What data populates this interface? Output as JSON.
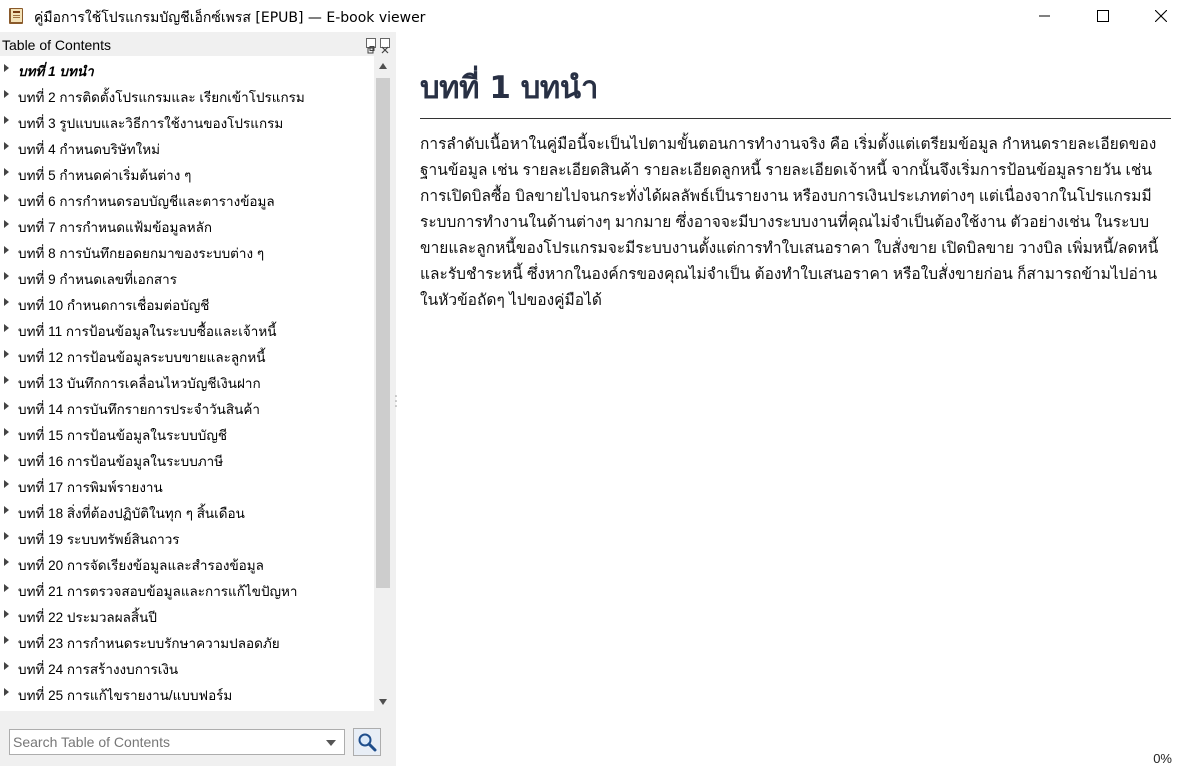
{
  "window": {
    "title": "คู่มือการใช้โปรแกรมบัญชีเอ็กซ์เพรส [EPUB] — E-book viewer",
    "icons": {
      "app": "book-icon",
      "minimize": "minimize-icon",
      "maximize": "maximize-icon",
      "close": "close-icon"
    }
  },
  "sidebar": {
    "header": "Table of Contents",
    "items": [
      {
        "label": "บทที่ 1 บทนำ",
        "current": true
      },
      {
        "label": "บทที่ 2 การติดตั้งโปรแกรมและ เรียกเข้าโปรแกรม"
      },
      {
        "label": "บทที่ 3 รูปแบบและวิธีการใช้งานของโปรแกรม"
      },
      {
        "label": "บทที่ 4 กำหนดบริษัทใหม่"
      },
      {
        "label": "บทที่ 5 กำหนดค่าเริ่มต้นต่าง ๆ"
      },
      {
        "label": "บทที่ 6 การกำหนดรอบบัญชีและตารางข้อมูล"
      },
      {
        "label": "บทที่ 7 การกำหนดแฟ้มข้อมูลหลัก"
      },
      {
        "label": "บทที่ 8 การบันทึกยอดยกมาของระบบต่าง ๆ"
      },
      {
        "label": "บทที่ 9 กำหนดเลขที่เอกสาร"
      },
      {
        "label": "บทที่ 10 กำหนดการเชื่อมต่อบัญชี"
      },
      {
        "label": "บทที่ 11 การป้อนข้อมูลในระบบซื้อและเจ้าหนี้"
      },
      {
        "label": "บทที่ 12  การป้อนข้อมูลระบบขายและลูกหนี้"
      },
      {
        "label": "บทที่ 13 บันทึกการเคลื่อนไหวบัญชีเงินฝาก"
      },
      {
        "label": "บทที่ 14 การบันทึกรายการประจำวันสินค้า"
      },
      {
        "label": "บทที่ 15 การป้อนข้อมูลในระบบบัญชี"
      },
      {
        "label": "บทที่ 16 การป้อนข้อมูลในระบบภาษี"
      },
      {
        "label": "บทที่ 17 การพิมพ์รายงาน"
      },
      {
        "label": "บทที่ 18 สิ่งที่ต้องปฏิบัติในทุก ๆ สิ้นเดือน"
      },
      {
        "label": "บทที่ 19 ระบบทรัพย์สินถาวร"
      },
      {
        "label": "บทที่ 20 การจัดเรียงข้อมูลและสำรองข้อมูล"
      },
      {
        "label": "บทที่ 21 การตรวจสอบข้อมูลและการแก้ไขปัญหา"
      },
      {
        "label": "บทที่ 22 ประมวลผลสิ้นปี"
      },
      {
        "label": "บทที่ 23 การกำหนดระบบรักษาความปลอดภัย"
      },
      {
        "label": "บทที่ 24 การสร้างงบการเงิน"
      },
      {
        "label": "บทที่ 25 การแก้ไขรายงาน/แบบฟอร์ม"
      }
    ],
    "search": {
      "placeholder": "Search Table of Contents",
      "value": ""
    }
  },
  "content": {
    "chapter_title": "บทที่ 1 บทนำ",
    "paragraph": "การลำดับเนื้อหาในคู่มือนี้จะเป็นไปตามขั้นตอนการทำงานจริง คือ เริ่มตั้งแต่เตรียมข้อมูล กำหนดรายละเอียดของฐานข้อมูล เช่น รายละเอียดสินค้า รายละเอียดลูกหนี้ รายละเอียดเจ้าหนี้ จากนั้นจึงเริ่มการป้อนข้อมูลรายวัน เช่น การเปิดบิลซื้อ บิลขายไปจนกระทั่งได้ผลลัพธ์เป็นรายงาน หรืองบการเงินประเภทต่างๆ แต่เนื่องจากในโปรแกรมมีระบบการทำงานในด้านต่างๆ มากมาย ซึ่งอาจจะมีบางระบบงานที่คุณไม่จำเป็นต้องใช้งาน ตัวอย่างเช่น ในระบบขายและลูกหนี้ของโปรแกรมจะมีระบบงานตั้งแต่การทำใบเสนอราคา ใบสั่งขาย เปิดบิลขาย วางบิล เพิ่มหนี้/ลดหนี้ และรับชำระหนี้ ซึ่งหากในองค์กรของคุณไม่จำเป็น ต้องทำใบเสนอราคา หรือใบสั่งขายก่อน ก็สามารถข้ามไปอ่านในหัวข้อถัดๆ ไปของคู่มือได้",
    "progress": "0%"
  }
}
